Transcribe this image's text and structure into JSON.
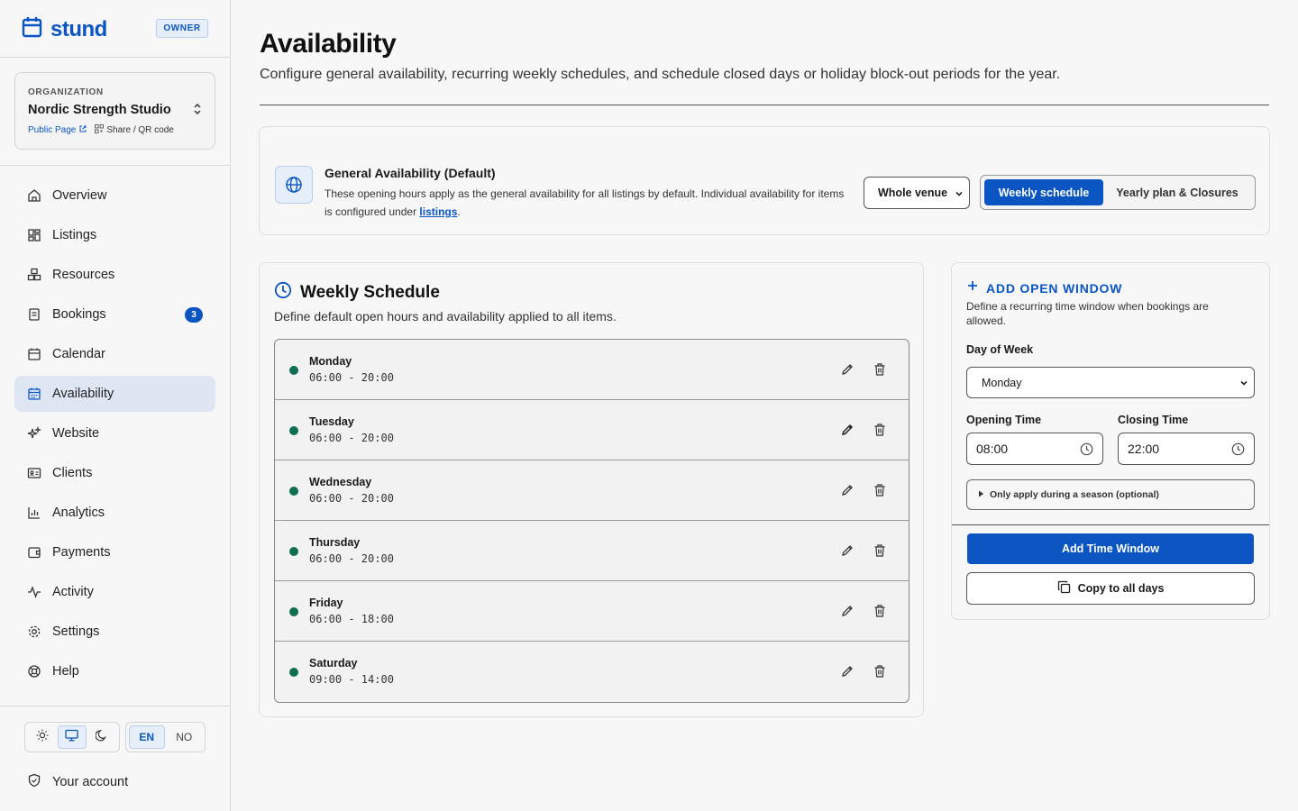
{
  "brand": {
    "name": "stund",
    "role_badge": "OWNER"
  },
  "organization": {
    "label": "ORGANIZATION",
    "name": "Nordic Strength Studio",
    "public_page": "Public Page",
    "share": "Share / QR code"
  },
  "nav": {
    "items": [
      {
        "label": "Overview",
        "icon": "home-icon"
      },
      {
        "label": "Listings",
        "icon": "grid-icon"
      },
      {
        "label": "Resources",
        "icon": "boxes-icon"
      },
      {
        "label": "Bookings",
        "icon": "clipboard-icon",
        "badge": "3"
      },
      {
        "label": "Calendar",
        "icon": "calendar-icon"
      },
      {
        "label": "Availability",
        "icon": "calendar-grid-icon",
        "active": true
      },
      {
        "label": "Website",
        "icon": "sparkles-icon"
      },
      {
        "label": "Clients",
        "icon": "id-card-icon"
      },
      {
        "label": "Analytics",
        "icon": "bar-chart-icon"
      },
      {
        "label": "Payments",
        "icon": "wallet-icon"
      },
      {
        "label": "Activity",
        "icon": "pulse-icon"
      },
      {
        "label": "Settings",
        "icon": "gear-icon"
      },
      {
        "label": "Help",
        "icon": "lifebuoy-icon"
      }
    ]
  },
  "footer": {
    "languages": [
      "EN",
      "NO"
    ],
    "active_language": "EN",
    "theme_active": "system",
    "account": "Your account"
  },
  "page": {
    "title": "Availability",
    "description": "Configure general availability, recurring weekly schedules, and schedule closed days or holiday block-out periods for the year."
  },
  "general": {
    "title": "General Availability (Default)",
    "desc_before": "These opening hours apply as the general availability for all listings by default. Individual availability for items is configured under ",
    "link": "listings",
    "desc_after": ".",
    "venue_select": "Whole venue",
    "tabs": {
      "weekly": "Weekly schedule",
      "yearly": "Yearly plan & Closures"
    },
    "active_tab": "weekly"
  },
  "weekly": {
    "title": "Weekly Schedule",
    "description": "Define default open hours and availability applied to all items.",
    "days": [
      {
        "day": "Monday",
        "hours": "06:00 - 20:00"
      },
      {
        "day": "Tuesday",
        "hours": "06:00 - 20:00"
      },
      {
        "day": "Wednesday",
        "hours": "06:00 - 20:00"
      },
      {
        "day": "Thursday",
        "hours": "06:00 - 20:00"
      },
      {
        "day": "Friday",
        "hours": "06:00 - 18:00"
      },
      {
        "day": "Saturday",
        "hours": "09:00 - 14:00"
      }
    ]
  },
  "add_window": {
    "title": "ADD OPEN WINDOW",
    "description": "Define a recurring time window when bookings are allowed.",
    "day_label": "Day of Week",
    "day_value": "Monday",
    "opening_label": "Opening Time",
    "opening_value": "08:00",
    "closing_label": "Closing Time",
    "closing_value": "22:00",
    "season": "Only apply during a season (optional)",
    "add_button": "Add Time Window",
    "copy_button": "Copy to all days"
  },
  "colors": {
    "accent": "#0b55c3",
    "status_open": "#0d6e52",
    "active_nav": "#dde6f2"
  }
}
